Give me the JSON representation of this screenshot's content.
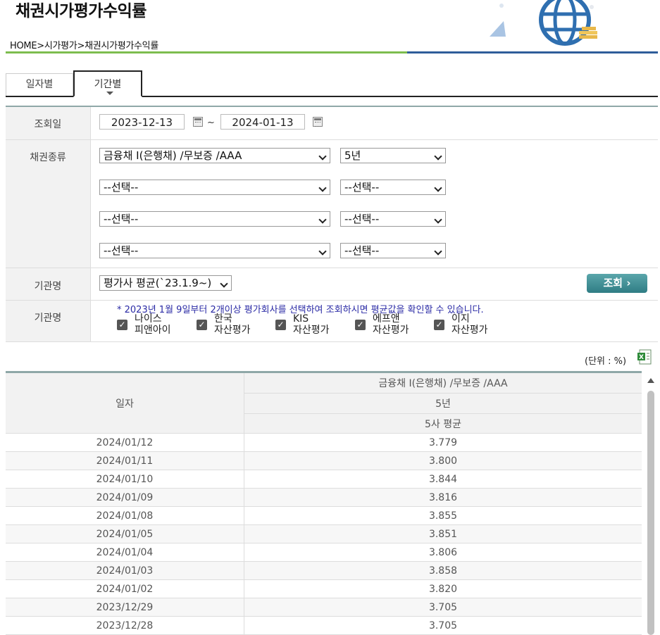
{
  "page": {
    "title": "채권시가평가수익률",
    "breadcrumb": "HOME>시가평가>채권시가평가수익률"
  },
  "tabs": [
    {
      "label": "일자별",
      "active": false
    },
    {
      "label": "기간별",
      "active": true
    }
  ],
  "form": {
    "date_label": "조회일",
    "date_from": "2023-12-13",
    "date_sep": "~",
    "date_to": "2024-01-13",
    "bond_label": "채권종류",
    "bond_rows": [
      {
        "type": "금융채 I(은행채) /무보증 /AAA",
        "term": "5년"
      },
      {
        "type": "--선택--",
        "term": "--선택--"
      },
      {
        "type": "--선택--",
        "term": "--선택--"
      },
      {
        "type": "--선택--",
        "term": "--선택--"
      }
    ],
    "agency_label": "기관명",
    "agency_value": "평가사 평균(`23.1.9~)",
    "search_button": "조회",
    "agency_label2": "기관명",
    "note": "* 2023년 1월 9일부터 2개이상 평가회사를 선택하여 조회하시면 평균값을 확인할 수 있습니다.",
    "agencies": [
      {
        "line1": "나이스",
        "line2": "피앤아이",
        "checked": true
      },
      {
        "line1": "한국",
        "line2": "자산평가",
        "checked": true
      },
      {
        "line1": "KIS",
        "line2": "자산평가",
        "checked": true
      },
      {
        "line1": "에프앤",
        "line2": "자산평가",
        "checked": true
      },
      {
        "line1": "이지",
        "line2": "자산평가",
        "checked": true
      }
    ]
  },
  "unit_text": "(단위 : %)",
  "table": {
    "col_date": "일자",
    "hdr1": "금융채 I(은행채) /무보증 /AAA",
    "hdr2": "5년",
    "hdr3": "5사 평균",
    "rows": [
      {
        "date": "2024/01/12",
        "value": "3.779"
      },
      {
        "date": "2024/01/11",
        "value": "3.800"
      },
      {
        "date": "2024/01/10",
        "value": "3.844"
      },
      {
        "date": "2024/01/09",
        "value": "3.816"
      },
      {
        "date": "2024/01/08",
        "value": "3.855"
      },
      {
        "date": "2024/01/05",
        "value": "3.851"
      },
      {
        "date": "2024/01/04",
        "value": "3.806"
      },
      {
        "date": "2024/01/03",
        "value": "3.858"
      },
      {
        "date": "2024/01/02",
        "value": "3.820"
      },
      {
        "date": "2023/12/29",
        "value": "3.705"
      },
      {
        "date": "2023/12/28",
        "value": "3.705"
      }
    ]
  }
}
